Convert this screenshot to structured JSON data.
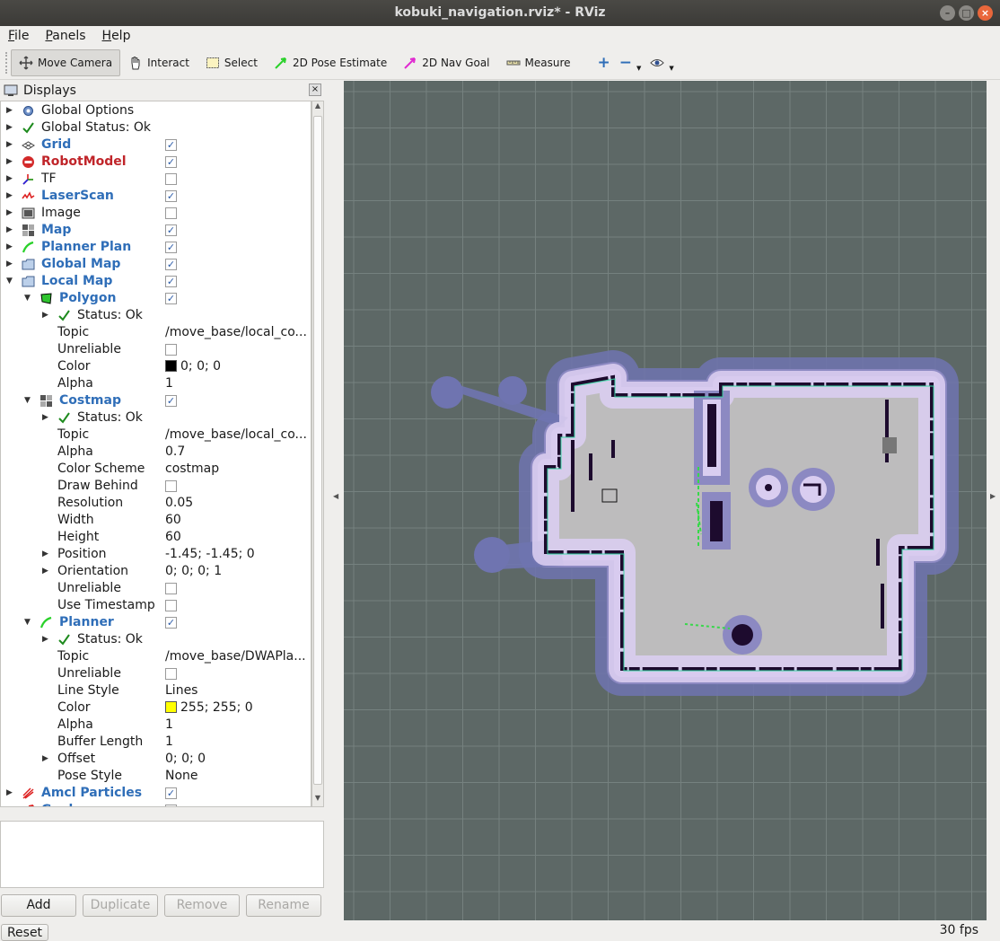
{
  "window": {
    "title": "kobuki_navigation.rviz* - RViz",
    "minimize": "–",
    "maximize": "□",
    "close": "×"
  },
  "menubar": [
    {
      "u": "F",
      "rest": "ile"
    },
    {
      "u": "P",
      "rest": "anels"
    },
    {
      "u": "H",
      "rest": "elp"
    }
  ],
  "toolbar": {
    "move_camera": "Move Camera",
    "interact": "Interact",
    "select": "Select",
    "pose_estimate": "2D Pose Estimate",
    "nav_goal": "2D Nav Goal",
    "measure": "Measure",
    "plus": "+",
    "minus": "−"
  },
  "panel": {
    "title": "Displays",
    "close": "×"
  },
  "tree": [
    {
      "indent": 0,
      "arrow": "▶",
      "icon": "gear-icon",
      "label": "Global Options"
    },
    {
      "indent": 0,
      "arrow": "▶",
      "icon": "check-icon",
      "label": "Global Status: Ok"
    },
    {
      "indent": 0,
      "arrow": "▶",
      "icon": "grid-icon",
      "label": "Grid",
      "style": "bold",
      "checked": true
    },
    {
      "indent": 0,
      "arrow": "▶",
      "icon": "error-icon",
      "label": "RobotModel",
      "style": "red",
      "checked": true
    },
    {
      "indent": 0,
      "arrow": "▶",
      "icon": "tf-icon",
      "label": "TF",
      "checked": false
    },
    {
      "indent": 0,
      "arrow": "▶",
      "icon": "laserscan-icon",
      "label": "LaserScan",
      "style": "bold",
      "checked": true
    },
    {
      "indent": 0,
      "arrow": "▶",
      "icon": "image-icon",
      "label": "Image",
      "checked": false
    },
    {
      "indent": 0,
      "arrow": "▶",
      "icon": "map-icon",
      "label": "Map",
      "style": "bold",
      "checked": true
    },
    {
      "indent": 0,
      "arrow": "▶",
      "icon": "path-icon",
      "label": "Planner Plan",
      "style": "bold",
      "checked": true
    },
    {
      "indent": 0,
      "arrow": "▶",
      "icon": "folder-icon",
      "label": "Global Map",
      "style": "bold",
      "checked": true
    },
    {
      "indent": 0,
      "arrow": "▼",
      "icon": "folder-icon",
      "label": "Local Map",
      "style": "bold",
      "checked": true
    },
    {
      "indent": 1,
      "arrow": "▼",
      "icon": "polygon-icon",
      "label": "Polygon",
      "style": "bold",
      "checked": true
    },
    {
      "indent": 2,
      "arrow": "▶",
      "icon": "check-icon",
      "label": "Status: Ok"
    },
    {
      "indent": 2,
      "label": "Topic",
      "value": "/move_base/local_co..."
    },
    {
      "indent": 2,
      "label": "Unreliable",
      "checked": false
    },
    {
      "indent": 2,
      "label": "Color",
      "value": "0; 0; 0",
      "swatch": "#000000"
    },
    {
      "indent": 2,
      "label": "Alpha",
      "value": "1"
    },
    {
      "indent": 1,
      "arrow": "▼",
      "icon": "map-icon",
      "label": "Costmap",
      "style": "bold",
      "checked": true
    },
    {
      "indent": 2,
      "arrow": "▶",
      "icon": "check-icon",
      "label": "Status: Ok"
    },
    {
      "indent": 2,
      "label": "Topic",
      "value": "/move_base/local_co..."
    },
    {
      "indent": 2,
      "label": "Alpha",
      "value": "0.7"
    },
    {
      "indent": 2,
      "label": "Color Scheme",
      "value": "costmap"
    },
    {
      "indent": 2,
      "label": "Draw Behind",
      "checked": false
    },
    {
      "indent": 2,
      "label": "Resolution",
      "value": "0.05"
    },
    {
      "indent": 2,
      "label": "Width",
      "value": "60"
    },
    {
      "indent": 2,
      "label": "Height",
      "value": "60"
    },
    {
      "indent": 2,
      "arrow": "▶",
      "label": "Position",
      "value": "-1.45; -1.45; 0"
    },
    {
      "indent": 2,
      "arrow": "▶",
      "label": "Orientation",
      "value": "0; 0; 0; 1"
    },
    {
      "indent": 2,
      "label": "Unreliable",
      "checked": false
    },
    {
      "indent": 2,
      "label": "Use Timestamp",
      "checked": false
    },
    {
      "indent": 1,
      "arrow": "▼",
      "icon": "path-icon",
      "label": "Planner",
      "style": "bold",
      "checked": true
    },
    {
      "indent": 2,
      "arrow": "▶",
      "icon": "check-icon",
      "label": "Status: Ok"
    },
    {
      "indent": 2,
      "label": "Topic",
      "value": "/move_base/DWAPla..."
    },
    {
      "indent": 2,
      "label": "Unreliable",
      "checked": false
    },
    {
      "indent": 2,
      "label": "Line Style",
      "value": "Lines"
    },
    {
      "indent": 2,
      "label": "Color",
      "value": "255; 255; 0",
      "swatch": "#ffff00"
    },
    {
      "indent": 2,
      "label": "Alpha",
      "value": "1"
    },
    {
      "indent": 2,
      "label": "Buffer Length",
      "value": "1"
    },
    {
      "indent": 2,
      "arrow": "▶",
      "label": "Offset",
      "value": "0; 0; 0"
    },
    {
      "indent": 2,
      "label": "Pose Style",
      "value": "None"
    },
    {
      "indent": 0,
      "arrow": "▶",
      "icon": "particles-icon",
      "label": "Amcl Particles",
      "style": "bold",
      "checked": true
    },
    {
      "indent": 0,
      "arrow": "▶",
      "icon": "goal-icon",
      "label": "Goal",
      "style": "bold",
      "checked": true
    }
  ],
  "buttons": {
    "add": "Add",
    "duplicate": "Duplicate",
    "remove": "Remove",
    "rename": "Rename"
  },
  "status": {
    "reset": "Reset",
    "fps": "30 fps"
  },
  "colors": {
    "viewport_bg": "#5d6866",
    "grid_line": "#8a9694",
    "free_space": "#bdbcbd",
    "inflation_outer": "#6f74b0",
    "inflation_inner": "#c8b8e8",
    "wall": "#1d0b2e",
    "laser": "#3ad9a6"
  }
}
